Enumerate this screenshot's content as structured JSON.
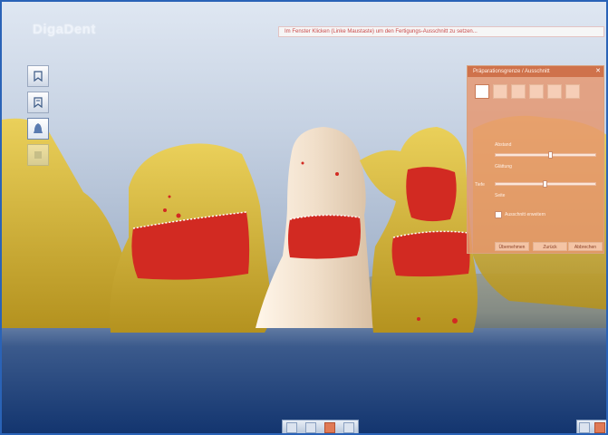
{
  "app": {
    "brand": "DigaDent"
  },
  "hint": {
    "text": "Im Fenster Klicken (Linke Maustaste) um den Fertigungs-Ausschnitt zu setzen..."
  },
  "left_toolbar": {
    "tools": [
      {
        "icon": "tooth-view-icon"
      },
      {
        "icon": "tooth-edit-icon"
      },
      {
        "icon": "bell-tooth-icon",
        "active": true
      },
      {
        "icon": "layer-icon",
        "disabled": true
      }
    ]
  },
  "panel": {
    "title": "Präparationsgrenze / Ausschnitt",
    "close_icon": "close-icon",
    "labels": {
      "dist": "Abstand",
      "smooth": "Glättung",
      "depth": "Tiefe",
      "side": "Seite",
      "option": "Ausschnitt erweitern"
    },
    "slider1_value": 0.55,
    "slider2_value": 0.5,
    "buttons": [
      "Übernehmen",
      "Zurück",
      "Abbrechen"
    ]
  },
  "colors": {
    "accent": "#2a63b7",
    "panel": "#e6966e",
    "margin_red": "#d22a22",
    "tooth_yellow": "#d8b43a"
  }
}
